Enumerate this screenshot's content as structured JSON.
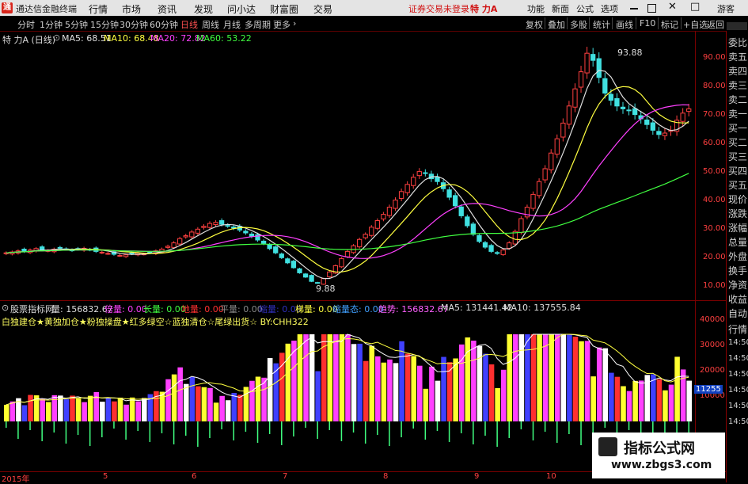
{
  "menubar": {
    "logo_text": "通",
    "app_title": "通达信金融终端",
    "menus": [
      "行情",
      "市场",
      "资讯",
      "发现",
      "问小达",
      "财富圈",
      "交易"
    ],
    "notice": "证券交易未登录",
    "stock_name": "特 力A",
    "right_buttons": [
      "功能",
      "新面",
      "公式",
      "选项"
    ],
    "guest": "游客"
  },
  "periods": [
    "分时",
    "1分钟",
    "5分钟",
    "15分钟",
    "30分钟",
    "60分钟",
    "日线",
    "周线",
    "月线",
    "多周期",
    "更多"
  ],
  "active_period": "日线",
  "toolbar_right": [
    "复权",
    "叠加",
    "多股",
    "统计",
    "画线",
    "F10",
    "标记",
    "+自选",
    "返回"
  ],
  "price_info": {
    "title": "特 力A (日线)",
    "ma5": "MA5: 68.51",
    "ma10": "MA10: 68.48",
    "ma20": "MA20: 72.82",
    "ma60": "MA60: 53.22"
  },
  "price_axis": [
    "90.00",
    "80.00",
    "70.00",
    "60.00",
    "50.00",
    "40.00",
    "30.00",
    "20.00",
    "10.00"
  ],
  "annotations": {
    "high": "93.88",
    "low": "9.88"
  },
  "indicator_info": {
    "title": "股票指标网",
    "vol": "量: 156832.67",
    "items": [
      {
        "label": "倍量: 0.00",
        "color": "#ff40ff"
      },
      {
        "label": "长量: 0.00",
        "color": "#40ff40"
      },
      {
        "label": "地量: 0.00",
        "color": "#ff3030"
      },
      {
        "label": "平量: 0.00",
        "color": "#aaaaaa"
      },
      {
        "label": "缩量: 0.00",
        "color": "#4040ff"
      },
      {
        "label": "梯量: 0.00",
        "color": "#ffff40"
      },
      {
        "label": "缩量态: 0.00",
        "color": "#40a0ff"
      },
      {
        "label": "趋势: 156832.67",
        "color": "#ff60ff"
      }
    ],
    "ma5": "MA5: 131441.42",
    "ma10": "MA10: 137555.84"
  },
  "legend_line": "白独建仓★黄独加仓★粉独操盘★红多绿空☆蓝独清仓☆尾绿出货☆ BY:CHH322",
  "volume_axis": [
    "40000",
    "30000",
    "20000",
    "10000"
  ],
  "volume_last": "11255",
  "date_axis": [
    "2015年",
    "5",
    "6",
    "7",
    "8",
    "9",
    "10"
  ],
  "side_tabs": [
    "委比",
    "卖五",
    "卖四",
    "卖三",
    "卖二",
    "卖一",
    "买一",
    "买二",
    "买三",
    "买四",
    "买五",
    "现价",
    "涨跌",
    "涨幅",
    "总量",
    "外盘",
    "换手",
    "净资",
    "收益"
  ],
  "side_tabs_lower": [
    "自动",
    "行情",
    "14:50",
    "14:50",
    "14:50",
    "14:50",
    "14:50",
    "14:50"
  ],
  "watermark": {
    "title": "指标公式网",
    "url": "www.zbgs3.com"
  },
  "chart_data": {
    "type": "candlestick",
    "ylim": [
      8,
      100
    ],
    "closes": [
      20.5,
      20.8,
      21.2,
      21.0,
      21.5,
      22.0,
      21.6,
      21.3,
      21.8,
      22.3,
      21.9,
      21.4,
      21.8,
      22.1,
      21.6,
      21.0,
      20.7,
      20.3,
      20.0,
      19.6,
      19.8,
      20.2,
      20.5,
      20.1,
      20.6,
      21.2,
      21.8,
      22.8,
      24.0,
      25.5,
      26.5,
      27.8,
      28.8,
      29.8,
      30.8,
      31.2,
      30.5,
      30.0,
      29.2,
      28.5,
      27.5,
      26.3,
      25.0,
      23.8,
      22.0,
      20.5,
      18.8,
      17.0,
      15.3,
      13.5,
      12.0,
      10.5,
      9.9,
      11.5,
      13.8,
      16.0,
      18.5,
      21.0,
      23.0,
      25.2,
      27.0,
      29.5,
      31.8,
      34.0,
      36.5,
      39.0,
      42.0,
      44.5,
      47.0,
      49.0,
      48.5,
      46.5,
      45.5,
      43.0,
      40.0,
      37.0,
      33.5,
      30.0,
      27.0,
      24.5,
      22.5,
      21.0,
      20.3,
      21.5,
      24.0,
      28.0,
      32.5,
      36.5,
      41.0,
      45.5,
      50.0,
      55.5,
      60.5,
      66.0,
      72.0,
      78.0,
      84.0,
      90.5,
      88.0,
      82.0,
      76.5,
      74.0,
      72.0,
      71.0,
      70.5,
      69.0,
      67.5,
      65.5,
      63.5,
      62.0,
      62.5,
      63.5,
      67.0,
      69.5,
      71.0
    ]
  }
}
